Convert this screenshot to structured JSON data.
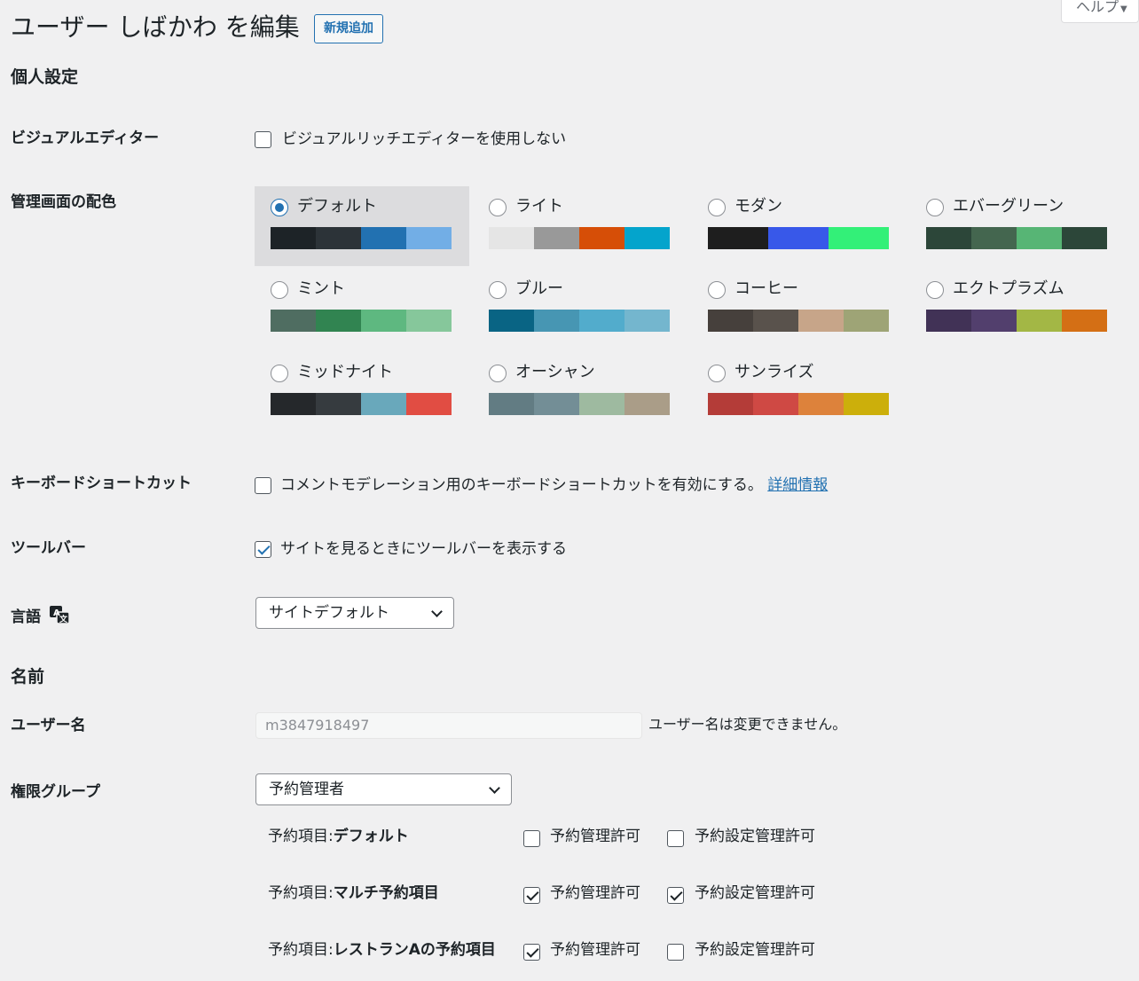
{
  "header": {
    "title": "ユーザー しばかわ を編集",
    "add_new": "新規追加",
    "help": "ヘルプ"
  },
  "personal": {
    "heading": "個人設定",
    "visual_editor": {
      "label": "ビジュアルエディター",
      "option": "ビジュアルリッチエディターを使用しない",
      "checked": false
    },
    "color_scheme": {
      "label": "管理画面の配色",
      "selected": "デフォルト",
      "schemes": [
        {
          "name": "デフォルト",
          "colors": [
            "#1d2327",
            "#2c3338",
            "#2271b1",
            "#72aee6"
          ]
        },
        {
          "name": "ライト",
          "colors": [
            "#e5e5e5",
            "#999999",
            "#d64e07",
            "#04a4cc"
          ]
        },
        {
          "name": "モダン",
          "colors": [
            "#1e1e1e",
            "#3858e9",
            "#33f078"
          ]
        },
        {
          "name": "エバーグリーン",
          "colors": [
            "#2c4639",
            "#44664f",
            "#57b575",
            "#2c4639"
          ]
        },
        {
          "name": "ミント",
          "colors": [
            "#4f6d61",
            "#318451",
            "#5eb880",
            "#86c79b"
          ]
        },
        {
          "name": "ブルー",
          "colors": [
            "#096484",
            "#4796b3",
            "#52accc",
            "#74b6ce"
          ]
        },
        {
          "name": "コーヒー",
          "colors": [
            "#46403c",
            "#59524c",
            "#c7a589",
            "#9ea476"
          ]
        },
        {
          "name": "エクトプラズム",
          "colors": [
            "#413256",
            "#523f6d",
            "#a3b745",
            "#d46f15"
          ]
        },
        {
          "name": "ミッドナイト",
          "colors": [
            "#25282b",
            "#363b3f",
            "#69a8bb",
            "#e14d43"
          ]
        },
        {
          "name": "オーシャン",
          "colors": [
            "#627c83",
            "#738e96",
            "#9ebaa0",
            "#aa9d88"
          ]
        },
        {
          "name": "サンライズ",
          "colors": [
            "#b43c38",
            "#cf4944",
            "#dd823b",
            "#ccaf0b"
          ]
        }
      ]
    },
    "keyboard": {
      "label": "キーボードショートカット",
      "option": "コメントモデレーション用のキーボードショートカットを有効にする。",
      "link": "詳細情報",
      "checked": false
    },
    "toolbar": {
      "label": "ツールバー",
      "option": "サイトを見るときにツールバーを表示する",
      "checked": true
    },
    "language": {
      "label": "言語",
      "value": "サイトデフォルト"
    }
  },
  "name_section": {
    "heading": "名前",
    "username": {
      "label": "ユーザー名",
      "value": "m3847918497",
      "note": "ユーザー名は変更できません。"
    },
    "group": {
      "label": "権限グループ",
      "value": "予約管理者"
    },
    "permissions": {
      "col1": "予約管理許可",
      "col2": "予約設定管理許可",
      "prefix": "予約項目:",
      "rows": [
        {
          "item": "デフォルト",
          "manage": false,
          "settings": false
        },
        {
          "item": "マルチ予約項目",
          "manage": true,
          "settings": true
        },
        {
          "item": "レストランAの予約項目",
          "manage": true,
          "settings": false
        }
      ]
    }
  }
}
